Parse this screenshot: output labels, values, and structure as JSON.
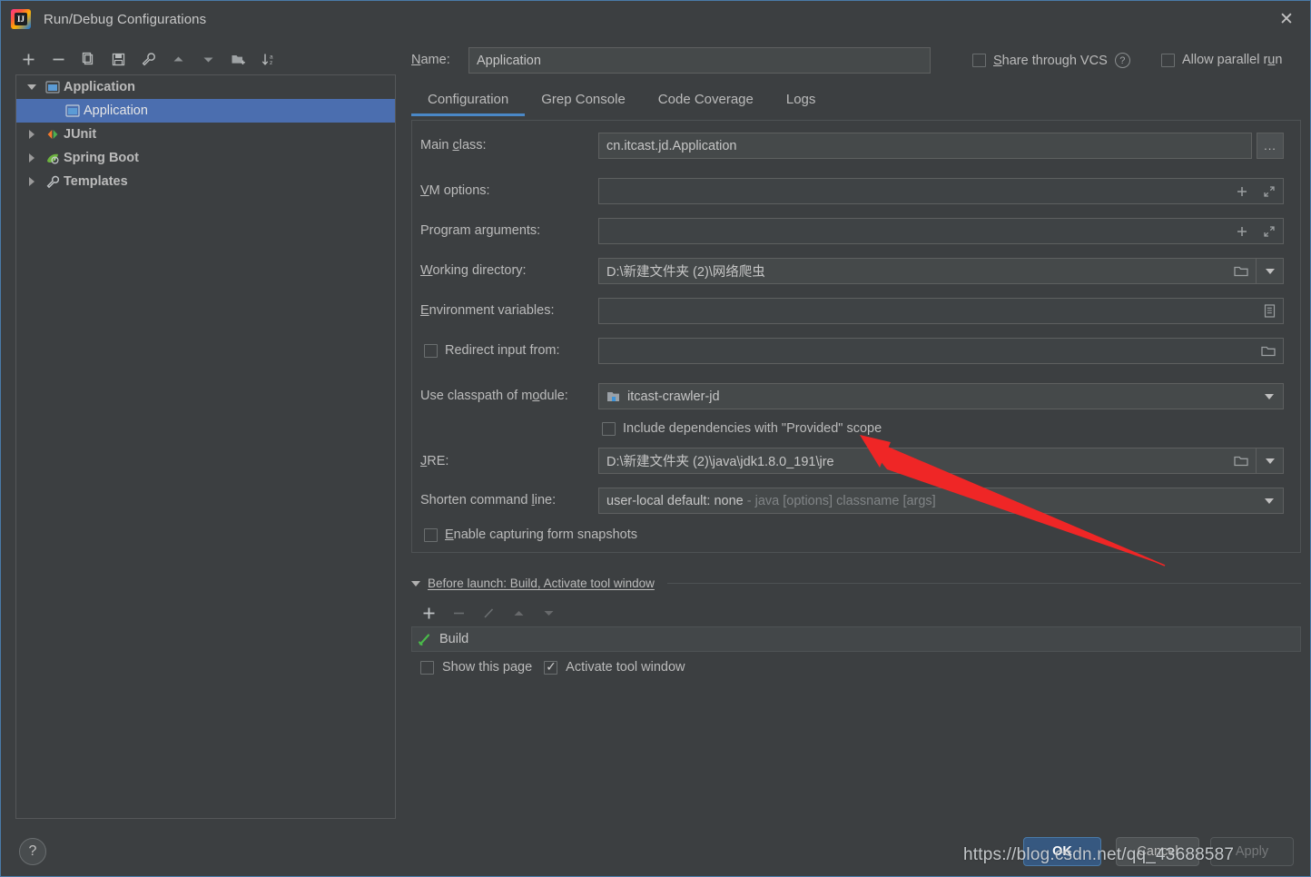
{
  "window": {
    "title": "Run/Debug Configurations",
    "logo_text": "IJ",
    "close_icon": "close-icon"
  },
  "left_toolbar": {
    "buttons": [
      {
        "name": "add-configuration-button",
        "icon": "plus-icon"
      },
      {
        "name": "remove-configuration-button",
        "icon": "minus-icon"
      },
      {
        "name": "copy-configuration-button",
        "icon": "copy-icon"
      },
      {
        "name": "save-configuration-button",
        "icon": "save-icon"
      },
      {
        "name": "edit-templates-button",
        "icon": "wrench-icon"
      },
      {
        "name": "move-up-button",
        "icon": "arrow-up-icon"
      },
      {
        "name": "move-down-button",
        "icon": "arrow-down-icon"
      },
      {
        "name": "new-folder-button",
        "icon": "new-folder-icon"
      },
      {
        "name": "sort-configurations-button",
        "icon": "sort-az-icon"
      }
    ]
  },
  "tree": {
    "items": [
      {
        "label": "Application",
        "icon": "application-icon",
        "twisty": "expanded",
        "depth": 0,
        "bold": true,
        "selected": false
      },
      {
        "label": "Application",
        "icon": "application-icon",
        "twisty": "none",
        "depth": 1,
        "bold": false,
        "selected": true
      },
      {
        "label": "JUnit",
        "icon": "junit-icon",
        "twisty": "collapsed",
        "depth": 0,
        "bold": true,
        "selected": false
      },
      {
        "label": "Spring Boot",
        "icon": "spring-boot-icon",
        "twisty": "collapsed",
        "depth": 0,
        "bold": true,
        "selected": false
      },
      {
        "label": "Templates",
        "icon": "wrench-icon",
        "twisty": "collapsed",
        "depth": 0,
        "bold": true,
        "selected": false
      }
    ]
  },
  "header": {
    "name_label": "Name:",
    "name_label_mnemonic": "N",
    "name_value": "Application",
    "share_vcs_label": "Share through VCS",
    "share_vcs_mnemonic": "S",
    "share_vcs_checked": false,
    "share_vcs_help_icon": "help-icon",
    "allow_parallel_label": "Allow parallel run",
    "allow_parallel_checked": false
  },
  "tabs": [
    {
      "label": "Configuration",
      "active": true
    },
    {
      "label": "Grep Console",
      "active": false
    },
    {
      "label": "Code Coverage",
      "active": false
    },
    {
      "label": "Logs",
      "active": false
    }
  ],
  "configuration": {
    "main_class": {
      "label": "Main class:",
      "value": "cn.itcast.jd.Application",
      "browse_label": "..."
    },
    "vm_options": {
      "label": "VM options:",
      "value": "",
      "icons": [
        "macro-plus-icon",
        "expand-icon"
      ]
    },
    "program_arguments": {
      "label": "Program arguments:",
      "value": "",
      "icons": [
        "macro-plus-icon",
        "expand-icon"
      ]
    },
    "working_directory": {
      "label": "Working directory:",
      "value": "D:\\新建文件夹 (2)\\网络爬虫",
      "icons": [
        "folder-icon",
        "chevron-down-icon"
      ]
    },
    "environment_variables": {
      "label": "Environment variables:",
      "value": "",
      "icons": [
        "env-list-icon"
      ]
    },
    "redirect_input": {
      "label": "Redirect input from:",
      "checked": false,
      "value": "",
      "icons": [
        "folder-icon"
      ]
    },
    "classpath_module": {
      "label": "Use classpath of module:",
      "value": "itcast-crawler-jd",
      "item_icon": "module-icon",
      "icons": [
        "chevron-down-icon"
      ]
    },
    "include_provided": {
      "label": "Include dependencies with \"Provided\" scope",
      "checked": false
    },
    "jre": {
      "label": "JRE:",
      "value": "D:\\新建文件夹 (2)\\java\\jdk1.8.0_191\\jre",
      "icons": [
        "folder-icon",
        "chevron-down-icon"
      ]
    },
    "shorten_command_line": {
      "label": "Shorten command line:",
      "value": "user-local default: none",
      "value_hint": " - java [options] classname [args]",
      "icons": [
        "chevron-down-icon"
      ]
    },
    "form_snapshots": {
      "label": "Enable capturing form snapshots",
      "checked": false
    }
  },
  "before_launch": {
    "header": "Before launch: Build, Activate tool window",
    "header_mnemonic": "B",
    "toolbar": [
      {
        "name": "add-task-button",
        "icon": "plus-icon",
        "enabled": true
      },
      {
        "name": "remove-task-button",
        "icon": "minus-icon",
        "enabled": false
      },
      {
        "name": "edit-task-button",
        "icon": "pencil-icon",
        "enabled": false
      },
      {
        "name": "move-task-up-button",
        "icon": "arrow-up-icon",
        "enabled": false
      },
      {
        "name": "move-task-down-button",
        "icon": "arrow-down-icon",
        "enabled": false
      }
    ],
    "tasks": [
      {
        "label": "Build",
        "icon": "build-hammer-icon"
      }
    ],
    "show_page_label": "Show this page",
    "show_page_checked": false,
    "activate_tool_window_label": "Activate tool window",
    "activate_tool_window_checked": true
  },
  "footer": {
    "help_label": "?",
    "ok_label": "OK",
    "cancel_label": "Cancel",
    "apply_label": "Apply",
    "apply_enabled": false
  },
  "annotation": {
    "watermark": "https://blog.csdn.net/qq_43688587",
    "arrow_color": "#ef2626",
    "arrow_name": "red-arrow-annotation"
  },
  "colors": {
    "background": "#3c3f41",
    "field_bg": "#45494a",
    "selection": "#4b6eaf",
    "accent": "#4a88c7",
    "primary_button": "#365880",
    "text": "#bbbbbb"
  }
}
